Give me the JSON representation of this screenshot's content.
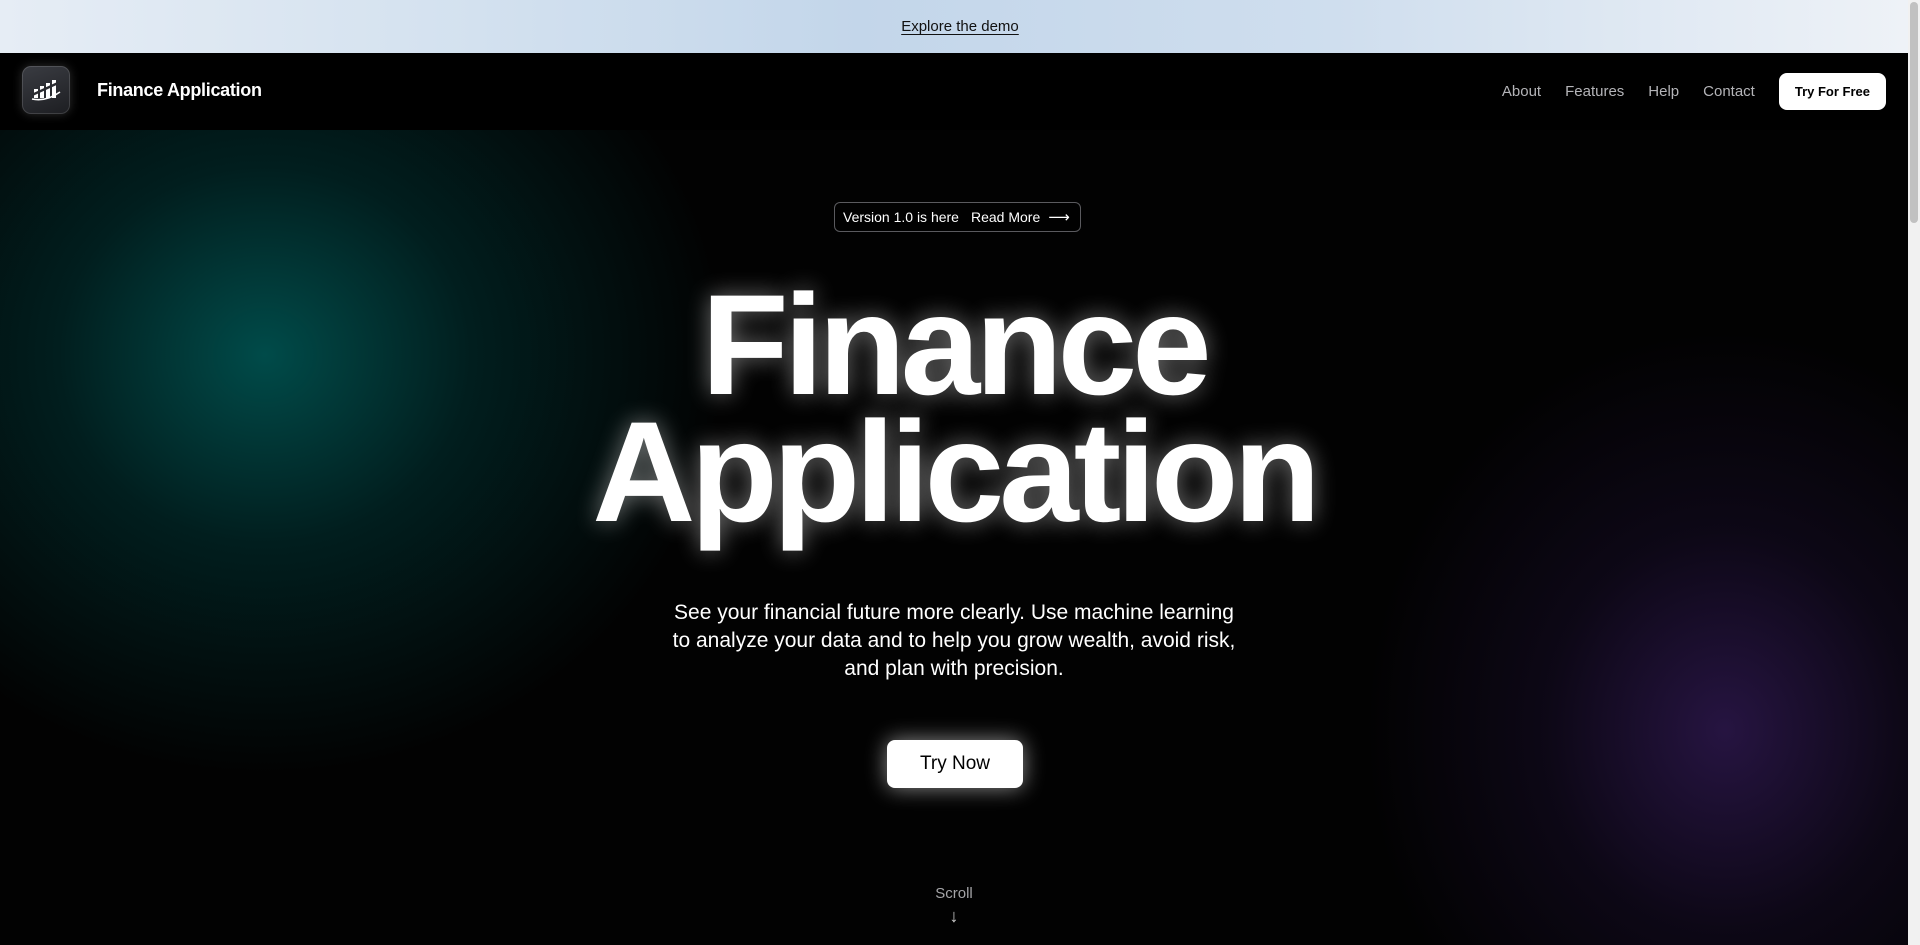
{
  "announcement": {
    "link_label": "Explore the demo"
  },
  "nav": {
    "brand": "Finance Application",
    "logo_icon": "rising-bar-chart-icon",
    "links": [
      "About",
      "Features",
      "Help",
      "Contact"
    ],
    "cta_label": "Try For Free"
  },
  "hero": {
    "pill_text": "Version 1.0 is here",
    "pill_link": "Read More",
    "pill_arrow": "⟶",
    "headline_line1": "Finance",
    "headline_line2": "Application",
    "subtitle_lines": [
      "See your financial future more clearly. Use machine learning",
      "to analyze your data and to help you grow wealth, avoid risk,",
      "and plan with precision."
    ],
    "primary_button": "Try Now",
    "scroll_label": "Scroll",
    "scroll_arrow": "↓"
  },
  "colors": {
    "background": "#000000",
    "teal_glow": "#005856",
    "purple_glow": "#2a1648",
    "announcement_bg": "#c3d6ea",
    "button_bg": "#ffffff"
  }
}
